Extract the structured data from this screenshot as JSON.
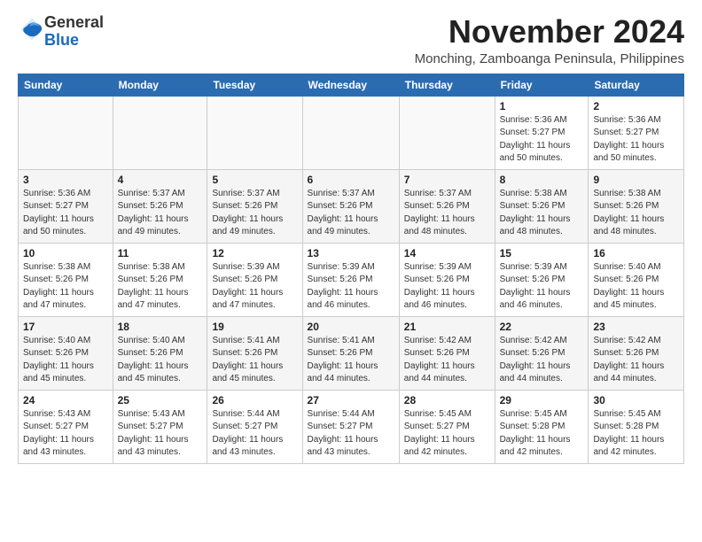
{
  "logo": {
    "text_general": "General",
    "text_blue": "Blue"
  },
  "header": {
    "title": "November 2024",
    "subtitle": "Monching, Zamboanga Peninsula, Philippines"
  },
  "weekdays": [
    "Sunday",
    "Monday",
    "Tuesday",
    "Wednesday",
    "Thursday",
    "Friday",
    "Saturday"
  ],
  "weeks": [
    [
      {
        "day": "",
        "info": ""
      },
      {
        "day": "",
        "info": ""
      },
      {
        "day": "",
        "info": ""
      },
      {
        "day": "",
        "info": ""
      },
      {
        "day": "",
        "info": ""
      },
      {
        "day": "1",
        "info": "Sunrise: 5:36 AM\nSunset: 5:27 PM\nDaylight: 11 hours\nand 50 minutes."
      },
      {
        "day": "2",
        "info": "Sunrise: 5:36 AM\nSunset: 5:27 PM\nDaylight: 11 hours\nand 50 minutes."
      }
    ],
    [
      {
        "day": "3",
        "info": "Sunrise: 5:36 AM\nSunset: 5:27 PM\nDaylight: 11 hours\nand 50 minutes."
      },
      {
        "day": "4",
        "info": "Sunrise: 5:37 AM\nSunset: 5:26 PM\nDaylight: 11 hours\nand 49 minutes."
      },
      {
        "day": "5",
        "info": "Sunrise: 5:37 AM\nSunset: 5:26 PM\nDaylight: 11 hours\nand 49 minutes."
      },
      {
        "day": "6",
        "info": "Sunrise: 5:37 AM\nSunset: 5:26 PM\nDaylight: 11 hours\nand 49 minutes."
      },
      {
        "day": "7",
        "info": "Sunrise: 5:37 AM\nSunset: 5:26 PM\nDaylight: 11 hours\nand 48 minutes."
      },
      {
        "day": "8",
        "info": "Sunrise: 5:38 AM\nSunset: 5:26 PM\nDaylight: 11 hours\nand 48 minutes."
      },
      {
        "day": "9",
        "info": "Sunrise: 5:38 AM\nSunset: 5:26 PM\nDaylight: 11 hours\nand 48 minutes."
      }
    ],
    [
      {
        "day": "10",
        "info": "Sunrise: 5:38 AM\nSunset: 5:26 PM\nDaylight: 11 hours\nand 47 minutes."
      },
      {
        "day": "11",
        "info": "Sunrise: 5:38 AM\nSunset: 5:26 PM\nDaylight: 11 hours\nand 47 minutes."
      },
      {
        "day": "12",
        "info": "Sunrise: 5:39 AM\nSunset: 5:26 PM\nDaylight: 11 hours\nand 47 minutes."
      },
      {
        "day": "13",
        "info": "Sunrise: 5:39 AM\nSunset: 5:26 PM\nDaylight: 11 hours\nand 46 minutes."
      },
      {
        "day": "14",
        "info": "Sunrise: 5:39 AM\nSunset: 5:26 PM\nDaylight: 11 hours\nand 46 minutes."
      },
      {
        "day": "15",
        "info": "Sunrise: 5:39 AM\nSunset: 5:26 PM\nDaylight: 11 hours\nand 46 minutes."
      },
      {
        "day": "16",
        "info": "Sunrise: 5:40 AM\nSunset: 5:26 PM\nDaylight: 11 hours\nand 45 minutes."
      }
    ],
    [
      {
        "day": "17",
        "info": "Sunrise: 5:40 AM\nSunset: 5:26 PM\nDaylight: 11 hours\nand 45 minutes."
      },
      {
        "day": "18",
        "info": "Sunrise: 5:40 AM\nSunset: 5:26 PM\nDaylight: 11 hours\nand 45 minutes."
      },
      {
        "day": "19",
        "info": "Sunrise: 5:41 AM\nSunset: 5:26 PM\nDaylight: 11 hours\nand 45 minutes."
      },
      {
        "day": "20",
        "info": "Sunrise: 5:41 AM\nSunset: 5:26 PM\nDaylight: 11 hours\nand 44 minutes."
      },
      {
        "day": "21",
        "info": "Sunrise: 5:42 AM\nSunset: 5:26 PM\nDaylight: 11 hours\nand 44 minutes."
      },
      {
        "day": "22",
        "info": "Sunrise: 5:42 AM\nSunset: 5:26 PM\nDaylight: 11 hours\nand 44 minutes."
      },
      {
        "day": "23",
        "info": "Sunrise: 5:42 AM\nSunset: 5:26 PM\nDaylight: 11 hours\nand 44 minutes."
      }
    ],
    [
      {
        "day": "24",
        "info": "Sunrise: 5:43 AM\nSunset: 5:27 PM\nDaylight: 11 hours\nand 43 minutes."
      },
      {
        "day": "25",
        "info": "Sunrise: 5:43 AM\nSunset: 5:27 PM\nDaylight: 11 hours\nand 43 minutes."
      },
      {
        "day": "26",
        "info": "Sunrise: 5:44 AM\nSunset: 5:27 PM\nDaylight: 11 hours\nand 43 minutes."
      },
      {
        "day": "27",
        "info": "Sunrise: 5:44 AM\nSunset: 5:27 PM\nDaylight: 11 hours\nand 43 minutes."
      },
      {
        "day": "28",
        "info": "Sunrise: 5:45 AM\nSunset: 5:27 PM\nDaylight: 11 hours\nand 42 minutes."
      },
      {
        "day": "29",
        "info": "Sunrise: 5:45 AM\nSunset: 5:28 PM\nDaylight: 11 hours\nand 42 minutes."
      },
      {
        "day": "30",
        "info": "Sunrise: 5:45 AM\nSunset: 5:28 PM\nDaylight: 11 hours\nand 42 minutes."
      }
    ]
  ]
}
